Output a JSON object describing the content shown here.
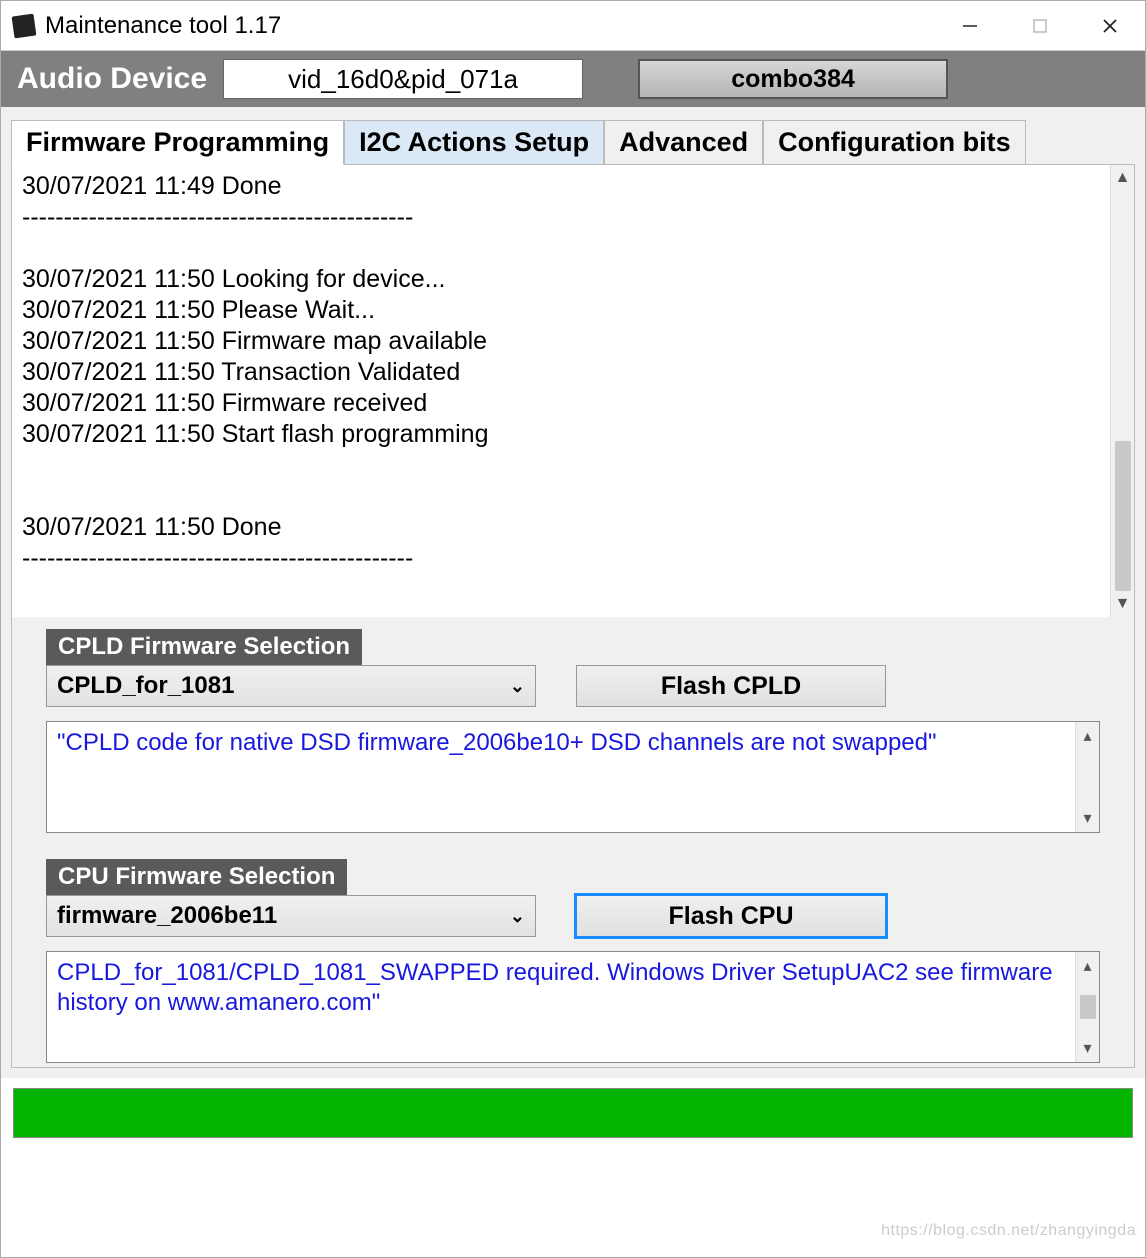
{
  "window": {
    "title": "Maintenance tool 1.17"
  },
  "header": {
    "label": "Audio Device",
    "device_value": "vid_16d0&pid_071a",
    "combo_label": "combo384"
  },
  "tabs": [
    {
      "label": "Firmware Programming"
    },
    {
      "label": "I2C Actions Setup"
    },
    {
      "label": "Advanced"
    },
    {
      "label": "Configuration bits"
    }
  ],
  "log": "30/07/2021 11:49 Done\n-----------------------------------------------\n\n30/07/2021 11:50 Looking for device...\n30/07/2021 11:50 Please Wait...\n30/07/2021 11:50 Firmware map available\n30/07/2021 11:50 Transaction Validated\n30/07/2021 11:50 Firmware received\n30/07/2021 11:50 Start flash programming\n\n\n30/07/2021 11:50 Done\n-----------------------------------------------",
  "cpld": {
    "section_label": "CPLD Firmware Selection",
    "selected": "CPLD_for_1081",
    "button": "Flash CPLD",
    "description": "\"CPLD code for native DSD firmware_2006be10+ DSD channels are not swapped\""
  },
  "cpu": {
    "section_label": "CPU Firmware Selection",
    "selected": "firmware_2006be11",
    "button": "Flash CPU",
    "description": "CPLD_for_1081/CPLD_1081_SWAPPED required. Windows Driver SetupUAC2 see firmware history on www.amanero.com\""
  },
  "watermark": "https://blog.csdn.net/zhangyingda"
}
